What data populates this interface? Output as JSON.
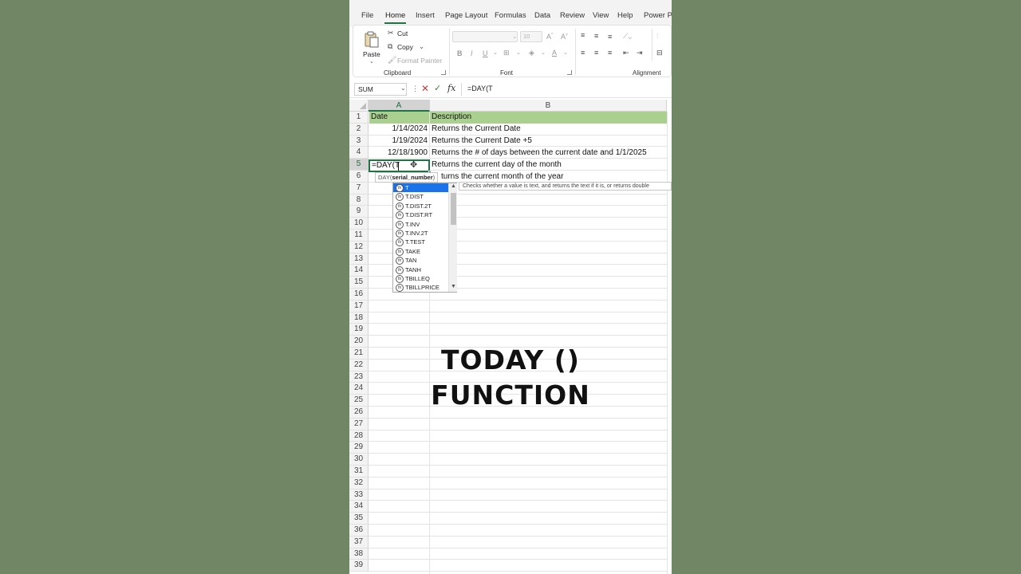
{
  "menu": {
    "items": [
      "File",
      "Home",
      "Insert",
      "Page Layout",
      "Formulas",
      "Data",
      "Review",
      "View",
      "Help",
      "Power Pi"
    ],
    "active": "Home"
  },
  "ribbon": {
    "clipboard": {
      "paste": "Paste",
      "cut": "Cut",
      "copy": "Copy",
      "format_painter": "Format Painter",
      "label": "Clipboard"
    },
    "font": {
      "size": "10",
      "label": "Font"
    },
    "alignment": {
      "label": "Alignment"
    }
  },
  "formula_bar": {
    "name_box": "SUM",
    "fx": "fx",
    "formula": "=DAY(T"
  },
  "grid": {
    "columns": [
      "A",
      "B"
    ],
    "selected_column": "A",
    "rows": [
      "1",
      "2",
      "3",
      "4",
      "5",
      "6",
      "7",
      "8",
      "9",
      "10",
      "11",
      "12",
      "13",
      "14",
      "15",
      "16",
      "17",
      "18",
      "19",
      "20",
      "21",
      "22",
      "23",
      "24",
      "25",
      "26",
      "27",
      "28",
      "29",
      "30",
      "31",
      "32",
      "33",
      "34",
      "35",
      "36",
      "37",
      "38",
      "39"
    ],
    "selected_row": "5",
    "header": {
      "a": "Date",
      "b": "Description"
    },
    "data": [
      {
        "a": "1/14/2024",
        "b": "Returns the Current Date"
      },
      {
        "a": "1/19/2024",
        "b": "Returns the Current Date +5"
      },
      {
        "a": "12/18/1900",
        "b": "Returns the # of days between the current date and 1/1/2025"
      },
      {
        "a": "=DAY(T",
        "b": "Returns the current day of the month"
      },
      {
        "a": "",
        "b": "turns the current month of the year"
      }
    ]
  },
  "arg_hint": {
    "func": "DAY(",
    "arg": "serial_number",
    "close": ")"
  },
  "autocomplete": {
    "items": [
      "T",
      "T.DIST",
      "T.DIST.2T",
      "T.DIST.RT",
      "T.INV",
      "T.INV.2T",
      "T.TEST",
      "TAKE",
      "TAN",
      "TANH",
      "TBILLEQ",
      "TBILLPRICE"
    ],
    "selected_index": 0,
    "tooltip": "Checks whether a value is text, and returns the text if it is, or returns double"
  },
  "caption": {
    "line1": "TODAY ()",
    "line2": "FUNCTION"
  }
}
